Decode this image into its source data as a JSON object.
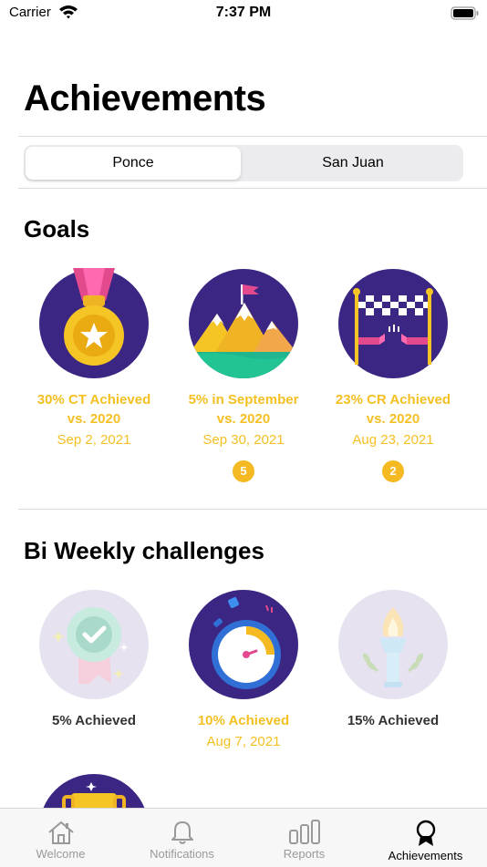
{
  "status": {
    "carrier": "Carrier",
    "time": "7:37 PM"
  },
  "page": {
    "title": "Achievements"
  },
  "segments": [
    {
      "label": "Ponce",
      "selected": true
    },
    {
      "label": "San Juan",
      "selected": false
    }
  ],
  "colors": {
    "accent": "#f4c023",
    "badge_bg": "#3b2783",
    "locked_bg": "#e6e2ef"
  },
  "goals": {
    "title": "Goals",
    "items": [
      {
        "title_line1": "30% CT Achieved",
        "title_line2": "vs. 2020",
        "date": "Sep 2, 2021",
        "icon": "medal-icon"
      },
      {
        "title_line1": "5% in September",
        "title_line2": "vs. 2020",
        "date": "Sep 30, 2021",
        "count": "5",
        "icon": "mountain-icon"
      },
      {
        "title_line1": "23% CR Achieved",
        "title_line2": "vs. 2020",
        "date": "Aug 23, 2021",
        "count": "2",
        "icon": "finish-line-icon"
      }
    ]
  },
  "challenges": {
    "title": "Bi Weekly challenges",
    "items": [
      {
        "title": "5% Achieved",
        "locked": true,
        "icon": "ribbon-icon"
      },
      {
        "title": "10% Achieved",
        "date": "Aug 7, 2021",
        "icon": "stopwatch-icon"
      },
      {
        "title": "15% Achieved",
        "locked": true,
        "icon": "torch-icon"
      }
    ]
  },
  "tabs": [
    {
      "label": "Welcome",
      "icon": "home-icon"
    },
    {
      "label": "Notifications",
      "icon": "bell-icon"
    },
    {
      "label": "Reports",
      "icon": "bar-chart-icon"
    },
    {
      "label": "Achievements",
      "icon": "ribbon-award-icon",
      "active": true
    }
  ]
}
